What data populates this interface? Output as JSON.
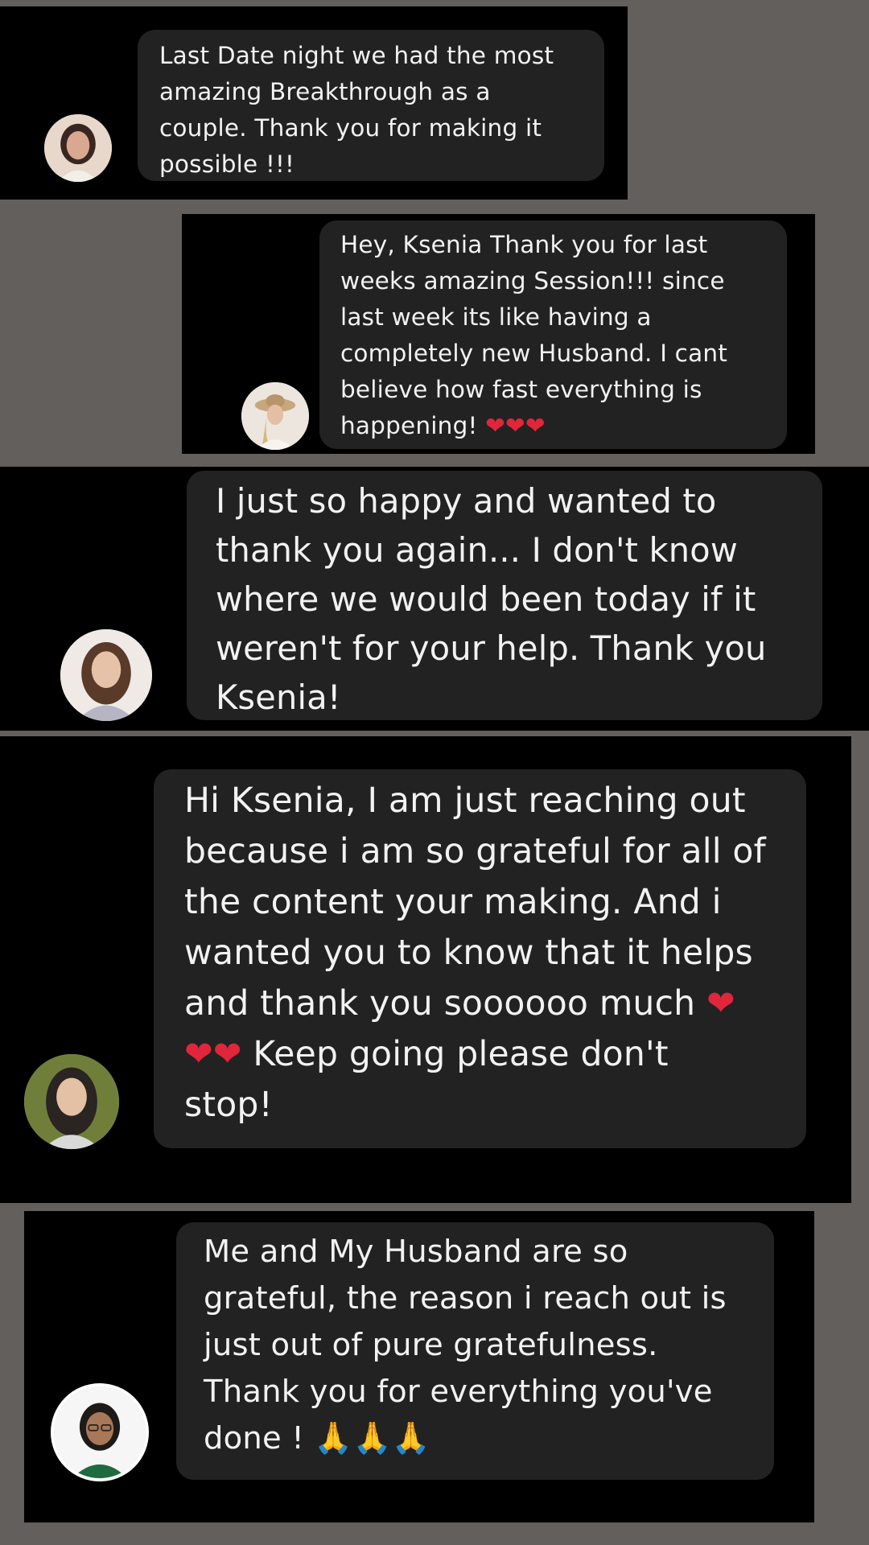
{
  "messages": [
    {
      "text": "Last Date night we had the most\namazing Breakthrough as a\ncouple. Thank you for making it\npossible !!!",
      "emoji": ""
    },
    {
      "text": "Hey, Ksenia Thank you for last\nweeks amazing Session!!! since\nlast week its like having a\ncompletely new Husband. I cant\nbelieve how fast everything is\nhappening! ",
      "emoji": "❤❤❤"
    },
    {
      "text": "I just so happy and wanted to\nthank you again... I don't know\nwhere we would been today if it\nweren't for your help. Thank you\nKsenia!",
      "emoji": ""
    },
    {
      "text_before": "Hi Ksenia, I am just reaching out\nbecause i am so grateful for all of\nthe content your making. And i\nwanted you to know that it helps\nand thank you soooooo much ",
      "emoji_a": "❤",
      "emoji_b": "❤❤",
      "text_after": " Keep going please don't\nstop!"
    },
    {
      "text": "Me and My Husband are so\ngrateful, the reason i reach out is\njust out of pure gratefulness.\nThank you for everything you've\ndone !  ",
      "emoji": "🙏🙏🙏"
    }
  ],
  "avatars": [
    {
      "icon": "woman-avatar-icon"
    },
    {
      "icon": "woman-hat-avatar-icon"
    },
    {
      "icon": "woman-avatar-icon"
    },
    {
      "icon": "woman-avatar-icon"
    },
    {
      "icon": "woman-glasses-avatar-icon"
    }
  ],
  "colors": {
    "page_background": "#635f5d",
    "panel_background": "#000000",
    "bubble_background": "#222222",
    "text": "#f2f2f2",
    "heart": "#e0263a"
  }
}
